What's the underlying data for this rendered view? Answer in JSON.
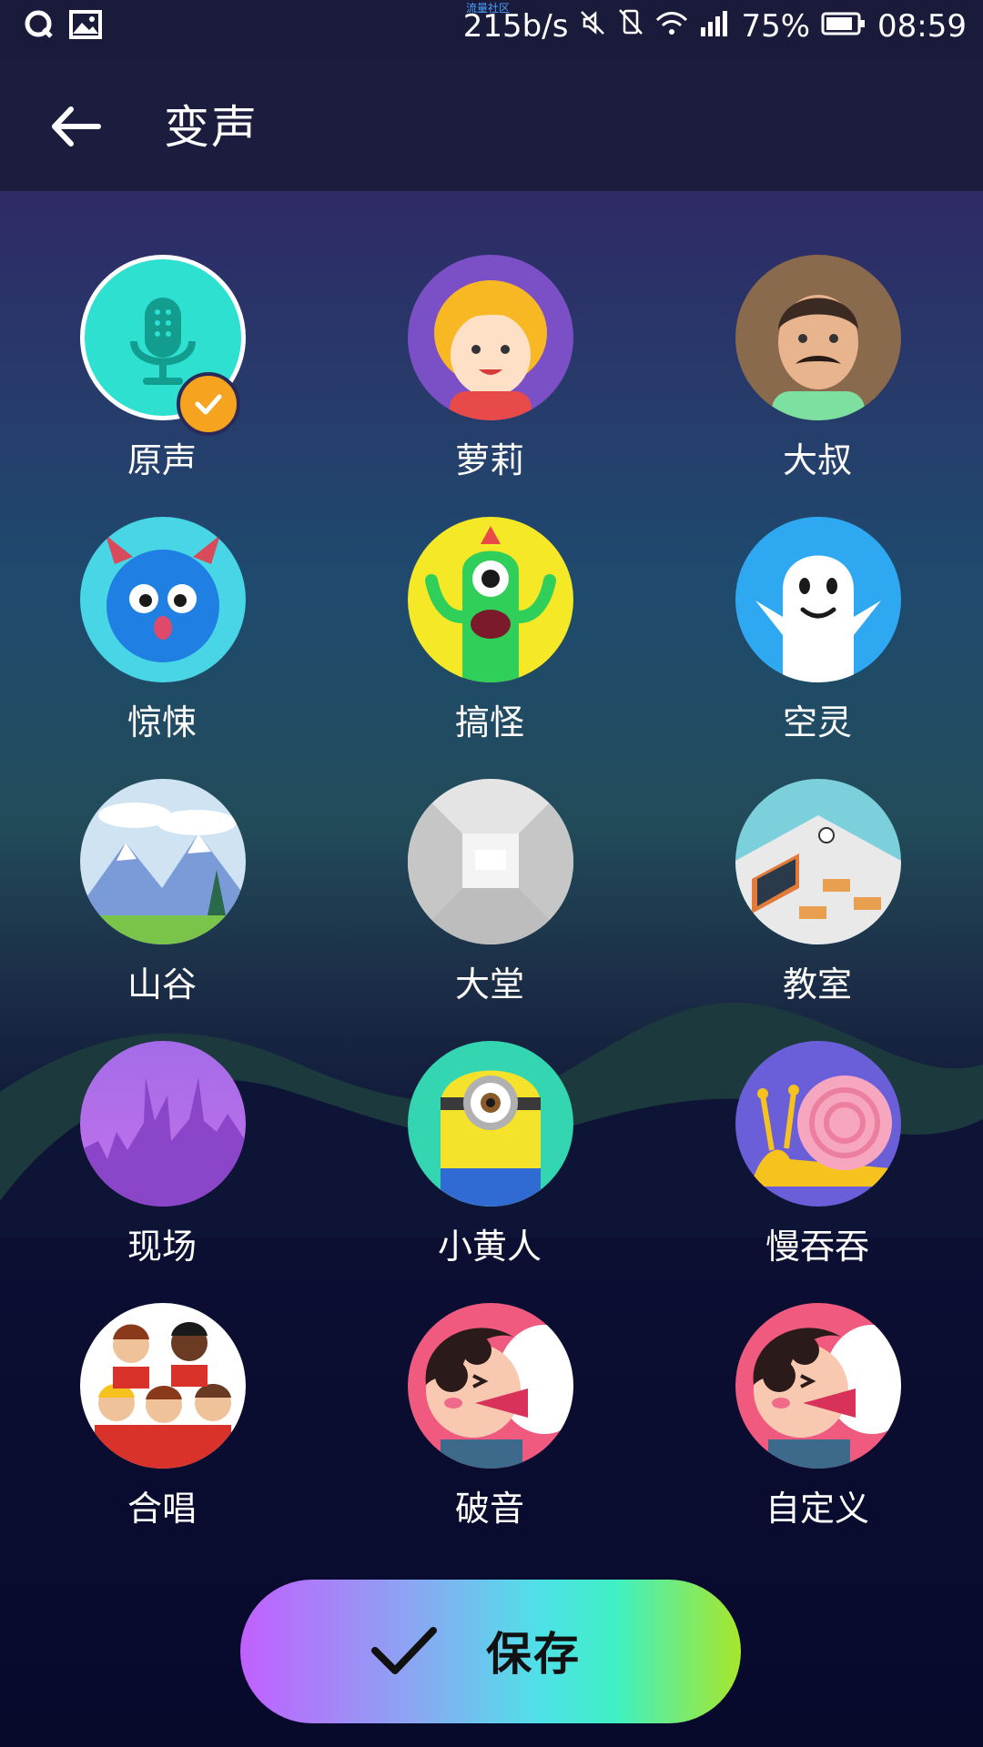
{
  "status_bar": {
    "tiny_text": "流量社区",
    "network_speed": "215b/s",
    "battery": "75%",
    "time": "08:59",
    "icons": [
      "qq-icon",
      "gallery-icon",
      "mute-icon",
      "vibrate-off-icon",
      "wifi-icon",
      "signal-icon",
      "battery-icon"
    ]
  },
  "app_bar": {
    "title": "变声"
  },
  "voices": [
    {
      "label": "原声",
      "icon": "microphone-icon",
      "selected": true
    },
    {
      "label": "萝莉",
      "icon": "girl-icon"
    },
    {
      "label": "大叔",
      "icon": "uncle-icon"
    },
    {
      "label": "惊悚",
      "icon": "monster-icon"
    },
    {
      "label": "搞怪",
      "icon": "alien-icon"
    },
    {
      "label": "空灵",
      "icon": "ghost-icon"
    },
    {
      "label": "山谷",
      "icon": "valley-icon"
    },
    {
      "label": "大堂",
      "icon": "hall-icon"
    },
    {
      "label": "教室",
      "icon": "classroom-icon"
    },
    {
      "label": "现场",
      "icon": "concert-icon"
    },
    {
      "label": "小黄人",
      "icon": "minion-icon"
    },
    {
      "label": "慢吞吞",
      "icon": "snail-icon"
    },
    {
      "label": "合唱",
      "icon": "choir-icon"
    },
    {
      "label": "破音",
      "icon": "shout-icon"
    },
    {
      "label": "自定义",
      "icon": "custom-shout-icon"
    }
  ],
  "save_button": {
    "label": "保存"
  },
  "colors": {
    "accent_orange": "#f6a41f",
    "save_gradient": [
      "#c160ff",
      "#4fe1e8",
      "#a8e62a"
    ]
  }
}
